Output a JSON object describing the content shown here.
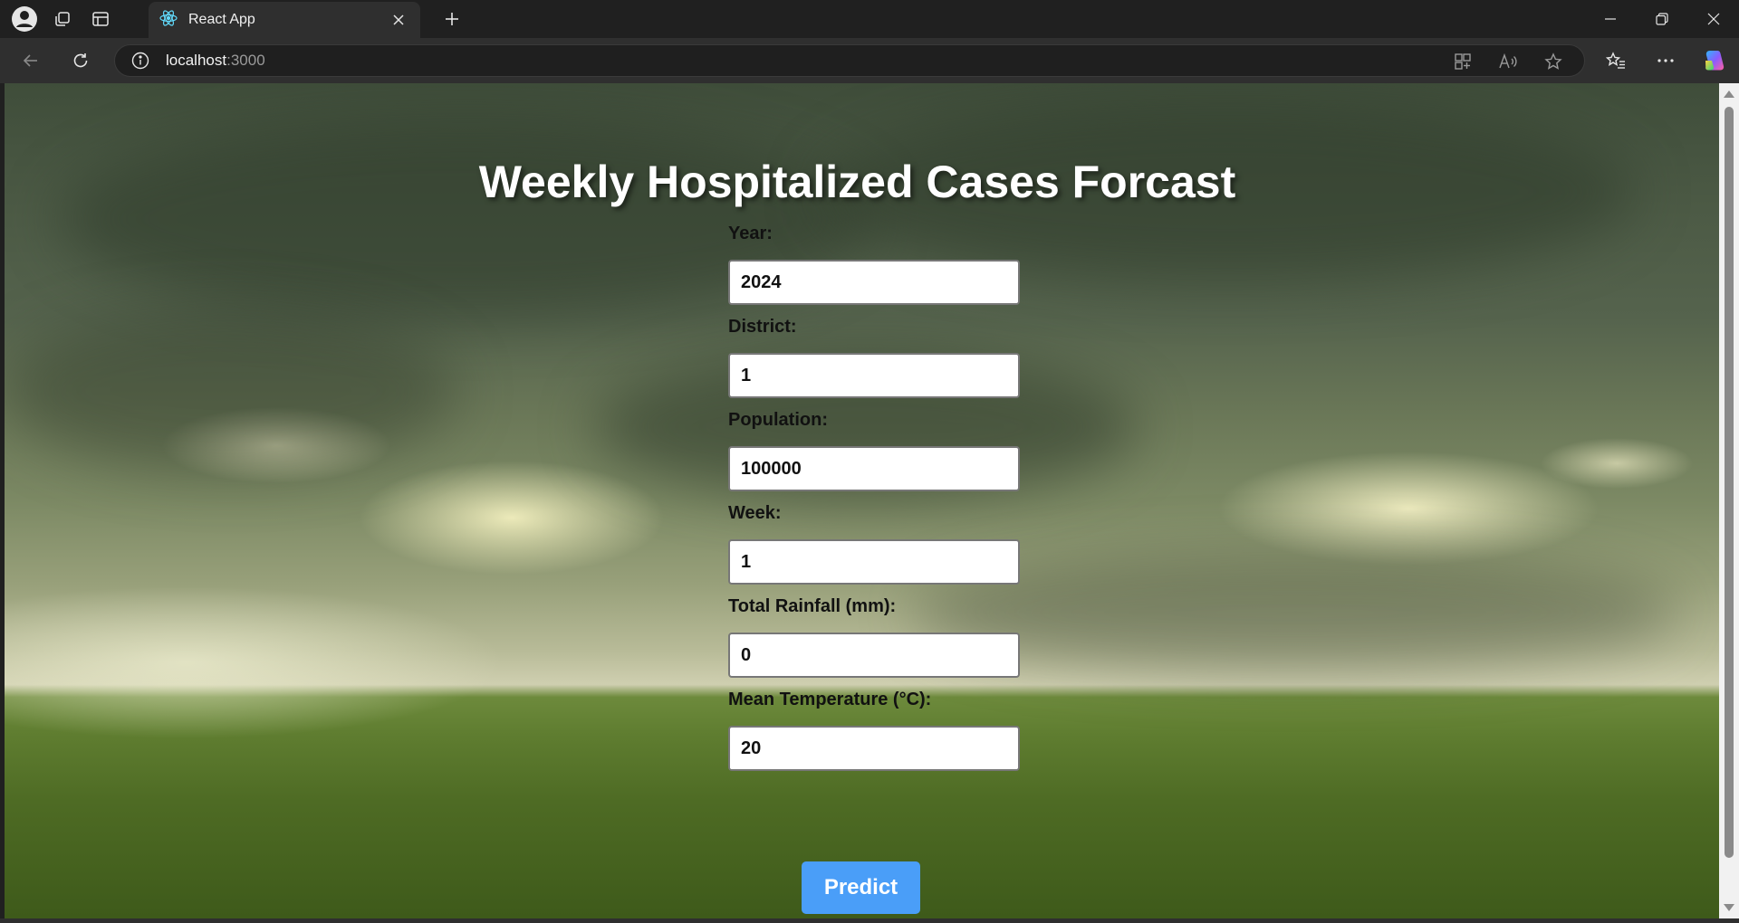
{
  "browser": {
    "tab_title": "React App",
    "url_host": "localhost",
    "url_port": ":3000"
  },
  "app": {
    "title": "Weekly Hospitalized Cases Forcast",
    "fields": [
      {
        "label": "Year:",
        "value": "2024"
      },
      {
        "label": "District:",
        "value": "1"
      },
      {
        "label": "Population:",
        "value": "100000"
      },
      {
        "label": "Week:",
        "value": "1"
      },
      {
        "label": "Total Rainfall (mm):",
        "value": "0"
      },
      {
        "label": "Mean Temperature (°C):",
        "value": "20"
      }
    ],
    "predict_label": "Predict",
    "predict_color": "#4a9ef8"
  }
}
